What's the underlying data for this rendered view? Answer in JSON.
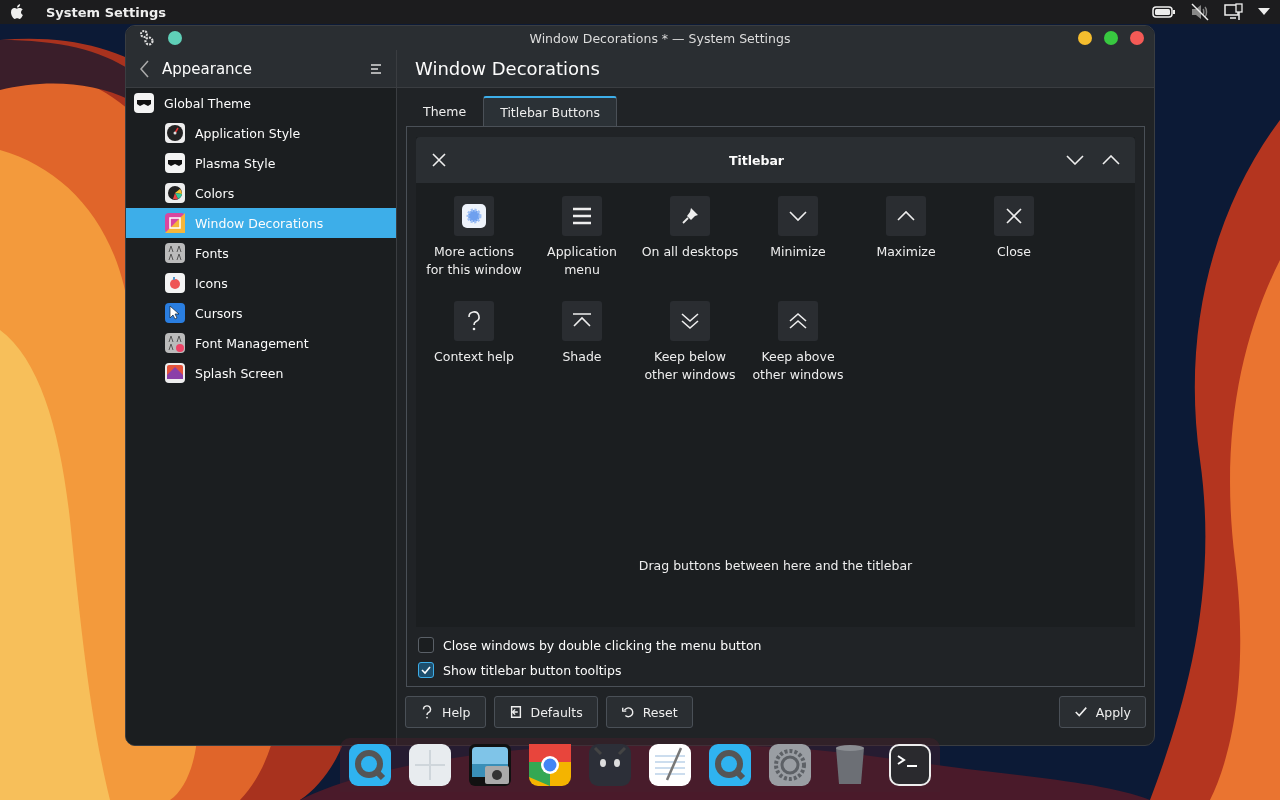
{
  "menu_bar": {
    "app_name": "System Settings"
  },
  "window": {
    "title": "Window Decorations * — System Settings"
  },
  "sidebar": {
    "header": "Appearance",
    "items": [
      {
        "label": "Global Theme",
        "kind": "theme",
        "selected": false,
        "children": [
          {
            "label": "Application Style",
            "kind": "gauge",
            "selected": false
          },
          {
            "label": "Plasma Style",
            "kind": "theme",
            "selected": false
          },
          {
            "label": "Colors",
            "kind": "colors",
            "selected": false
          },
          {
            "label": "Window Decorations",
            "kind": "decor",
            "selected": true
          },
          {
            "label": "Fonts",
            "kind": "fonts",
            "selected": false
          },
          {
            "label": "Icons",
            "kind": "icons",
            "selected": false
          },
          {
            "label": "Cursors",
            "kind": "cursor",
            "selected": false
          },
          {
            "label": "Font Management",
            "kind": "fontmgr",
            "selected": false
          },
          {
            "label": "Splash Screen",
            "kind": "splash",
            "selected": false
          }
        ]
      }
    ]
  },
  "page": {
    "title": "Window Decorations",
    "tabs": [
      {
        "label": "Theme",
        "selected": false
      },
      {
        "label": "Titlebar Buttons",
        "selected": true
      }
    ],
    "titlebar": {
      "title": "Titlebar"
    },
    "buttons": [
      {
        "label": "More actions\nfor this window",
        "kind": "menu"
      },
      {
        "label": "Application\nmenu",
        "kind": "appmenu"
      },
      {
        "label": "On all desktops",
        "kind": "pin"
      },
      {
        "label": "Minimize",
        "kind": "minimize"
      },
      {
        "label": "Maximize",
        "kind": "maximize"
      },
      {
        "label": "Close",
        "kind": "close"
      },
      {
        "label": "Context help",
        "kind": "help"
      },
      {
        "label": "Shade",
        "kind": "shade"
      },
      {
        "label": "Keep below\nother windows",
        "kind": "below"
      },
      {
        "label": "Keep above\nother windows",
        "kind": "above"
      }
    ],
    "hint": "Drag buttons between here and the titlebar",
    "options": [
      {
        "label": "Close windows by double clicking the menu button",
        "checked": false
      },
      {
        "label": "Show titlebar button tooltips",
        "checked": true
      }
    ]
  },
  "footer": {
    "left": [
      {
        "label": "Help",
        "kind": "help"
      },
      {
        "label": "Defaults",
        "kind": "defaults"
      },
      {
        "label": "Reset",
        "kind": "reset"
      }
    ],
    "right": [
      {
        "label": "Apply",
        "kind": "apply"
      }
    ]
  }
}
